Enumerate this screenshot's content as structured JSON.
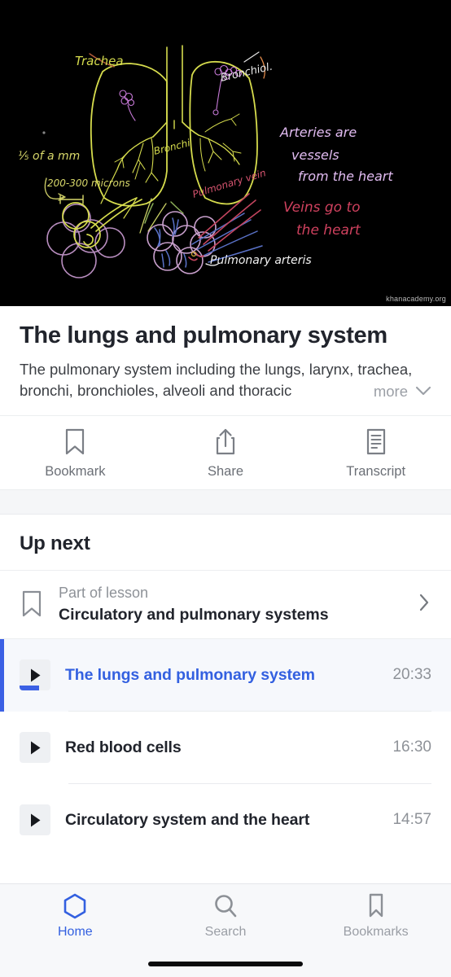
{
  "video": {
    "watermark": "khanacademy.org",
    "annotations": [
      {
        "text": "Trachea",
        "color": "#e3e84a"
      },
      {
        "text": "Bronchi",
        "color": "#e3e84a"
      },
      {
        "text": "Bronchiol.",
        "color": "#f0f0f0"
      },
      {
        "text": "1/5 of a mm",
        "color": "#d8d86a"
      },
      {
        "text": "200-300 microns",
        "color": "#d8d86a"
      },
      {
        "text": "Pulmonary vein",
        "color": "#d95f79"
      },
      {
        "text": "Pulmonary arteris",
        "color": "#ffffff"
      },
      {
        "text": "Arteries are vessels from the heart",
        "color": "#e0b8f0"
      },
      {
        "text": "Veins go to the heart",
        "color": "#d0415f"
      }
    ]
  },
  "info": {
    "title": "The lungs and pulmonary system",
    "description": "The pulmonary system including the lungs, larynx, trachea, bronchi, bronchioles, alveoli and thoracic",
    "more_label": "more"
  },
  "actions": [
    {
      "label": "Bookmark",
      "icon": "bookmark-icon"
    },
    {
      "label": "Share",
      "icon": "share-icon"
    },
    {
      "label": "Transcript",
      "icon": "transcript-icon"
    }
  ],
  "up_next": {
    "heading": "Up next",
    "lesson": {
      "kicker": "Part of lesson",
      "name": "Circulatory and pulmonary systems"
    },
    "videos": [
      {
        "title": "The lungs and pulmonary system",
        "duration": "20:33",
        "active": true,
        "progress_pct": 62
      },
      {
        "title": "Red blood cells",
        "duration": "16:30",
        "active": false,
        "progress_pct": 0
      },
      {
        "title": "Circulatory system and the heart",
        "duration": "14:57",
        "active": false,
        "progress_pct": 0
      }
    ]
  },
  "tabbar": [
    {
      "label": "Home",
      "icon": "hexagon-home-icon",
      "active": true
    },
    {
      "label": "Search",
      "icon": "search-icon",
      "active": false
    },
    {
      "label": "Bookmarks",
      "icon": "bookmark-icon",
      "active": false
    }
  ],
  "colors": {
    "accent": "#3360e0",
    "active_row_bg": "#f6f8fc",
    "text_primary": "#21242c",
    "text_muted": "#8e9298",
    "divider": "#e9ebee"
  }
}
